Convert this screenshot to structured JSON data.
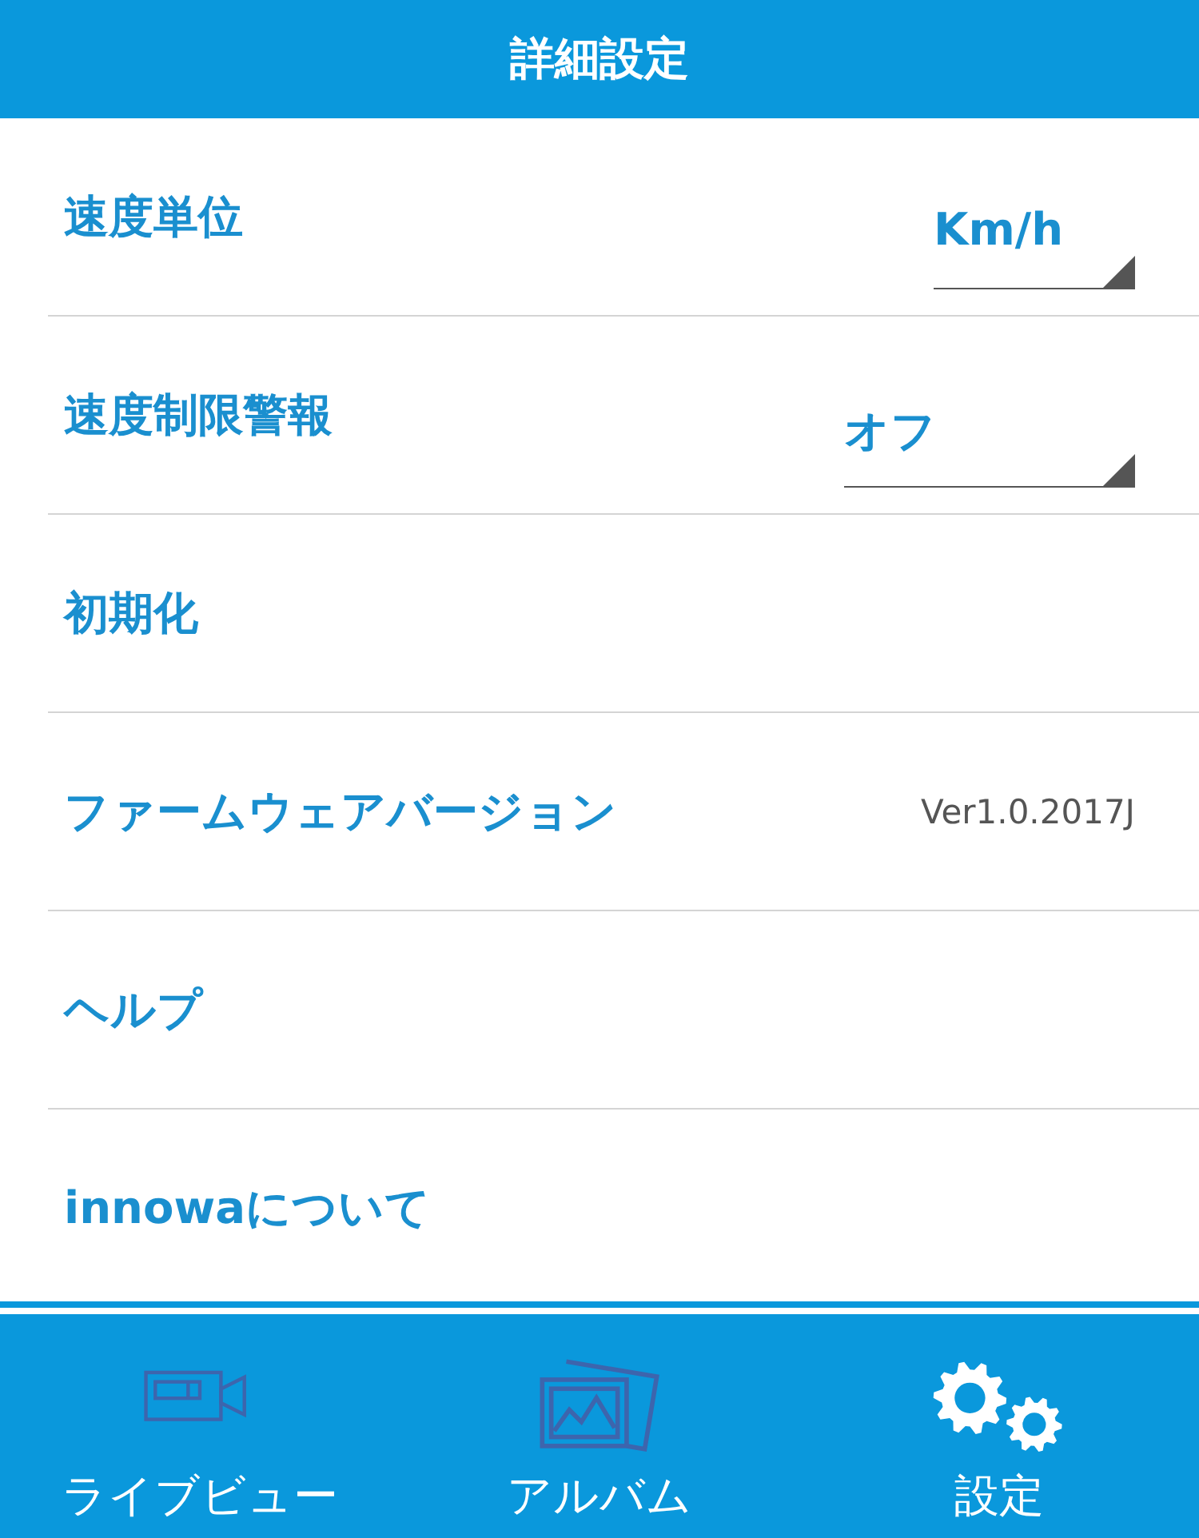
{
  "header": {
    "title": "詳細設定"
  },
  "rows": [
    {
      "kind": "select",
      "label": "速度単位",
      "value": "Km/h"
    },
    {
      "kind": "select",
      "label": "速度制限警報",
      "value": "オフ"
    },
    {
      "kind": "plain",
      "label": "初期化"
    },
    {
      "kind": "info",
      "label": "ファームウェアバージョン",
      "value": "Ver1.0.2017J"
    },
    {
      "kind": "plain",
      "label": "ヘルプ"
    },
    {
      "kind": "plain",
      "label": "innowaについて"
    }
  ],
  "tabs": [
    {
      "kind": "camera",
      "label": "ライブビュー",
      "selected": false
    },
    {
      "kind": "album",
      "label": "アルバム",
      "selected": false
    },
    {
      "kind": "gears",
      "label": "設定",
      "selected": true
    }
  ]
}
